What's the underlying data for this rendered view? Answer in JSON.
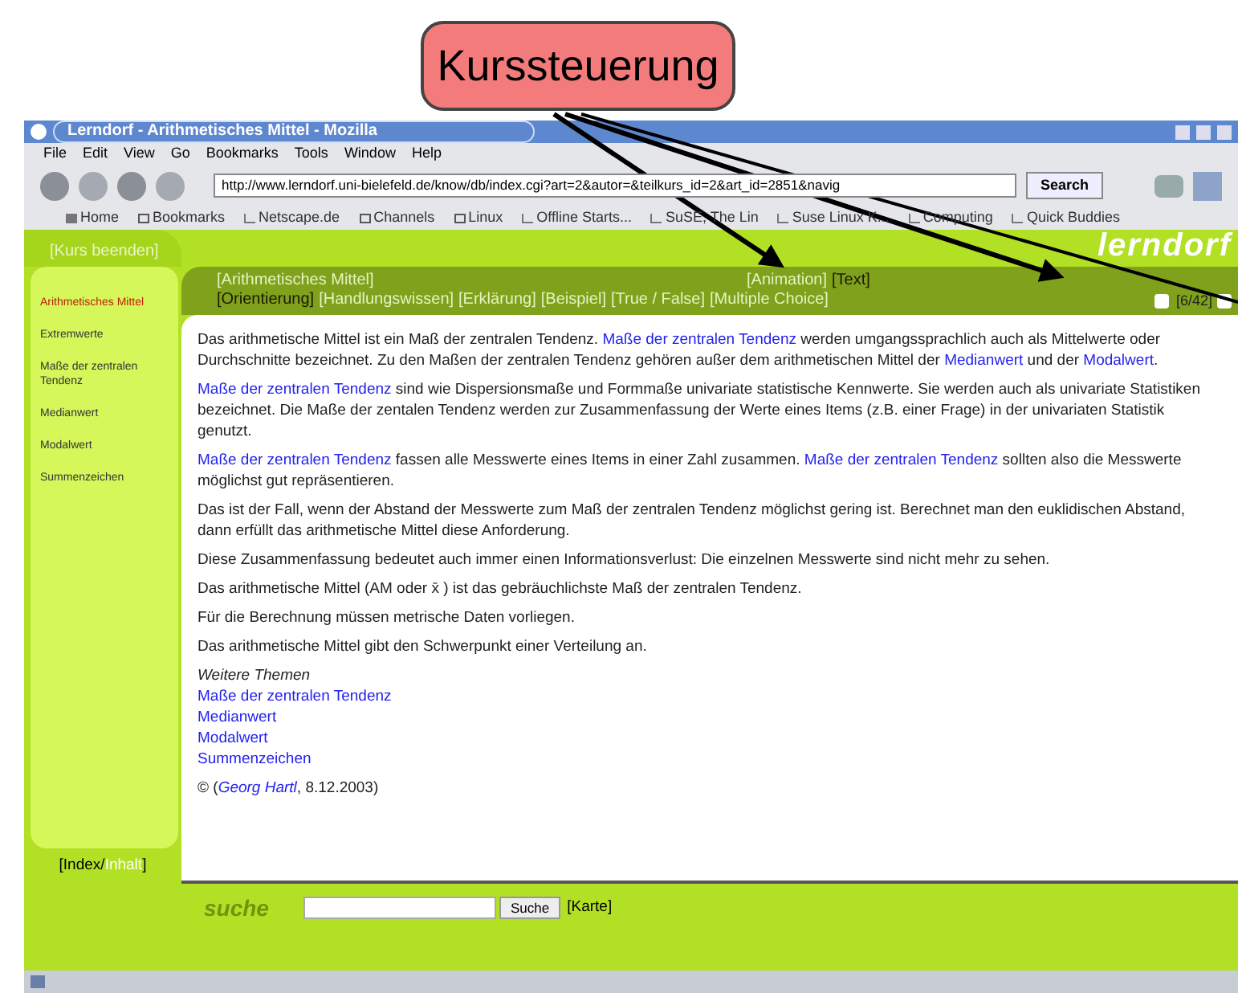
{
  "callout": {
    "label": "Kurssteuerung"
  },
  "window": {
    "title": "Lerndorf - Arithmetisches Mittel - Mozilla"
  },
  "menu": [
    "File",
    "Edit",
    "View",
    "Go",
    "Bookmarks",
    "Tools",
    "Window",
    "Help"
  ],
  "address": {
    "value": "http://www.lerndorf.uni-bielefeld.de/know/db/index.cgi?art=2&autor=&teilkurs_id=2&art_id=2851&navig"
  },
  "search_button": "Search",
  "bookmarks": [
    {
      "label": "Home",
      "kind": "home"
    },
    {
      "label": "Bookmarks",
      "kind": "folder"
    },
    {
      "label": "Netscape.de",
      "kind": "link"
    },
    {
      "label": "Channels",
      "kind": "folder"
    },
    {
      "label": "Linux",
      "kind": "folder"
    },
    {
      "label": "Offline Starts...",
      "kind": "link"
    },
    {
      "label": "SuSE, The Lin",
      "kind": "link"
    },
    {
      "label": "Suse Linux K...",
      "kind": "link"
    },
    {
      "label": "Computing",
      "kind": "link"
    },
    {
      "label": "Quick Buddies",
      "kind": "link"
    }
  ],
  "page": {
    "end_course": "[Kurs beenden]",
    "sidebar": [
      {
        "label": "Arithmetisches Mittel",
        "selected": true
      },
      {
        "label": "Extremwerte",
        "selected": false
      },
      {
        "label": "Maße der zentralen Tendenz",
        "selected": false
      },
      {
        "label": "Medianwert",
        "selected": false
      },
      {
        "label": "Modalwert",
        "selected": false
      },
      {
        "label": "Summenzeichen",
        "selected": false
      }
    ],
    "topic": "[Arithmetisches Mittel]",
    "media_tabs": [
      {
        "label": "[Animation]",
        "selected": false
      },
      {
        "label": "[Text]",
        "selected": true
      }
    ],
    "section_tabs": [
      {
        "label": "[Orientierung]",
        "selected": true
      },
      {
        "label": "[Handlungswissen]",
        "selected": false
      },
      {
        "label": "[Erklärung]",
        "selected": false
      },
      {
        "label": "[Beispiel]",
        "selected": false
      },
      {
        "label": "[True / False]",
        "selected": false
      },
      {
        "label": "[Multiple Choice]",
        "selected": false
      }
    ],
    "logo": "lerndorf",
    "pager": "[6/42]",
    "paragraphs": [
      [
        {
          "text": "Das arithmetische Mittel ist ein Maß der zentralen Tendenz. ",
          "kind": "text"
        },
        {
          "text": "Maße der zentralen Tendenz",
          "kind": "link"
        },
        {
          "text": " werden umgangssprachlich auch als Mittelwerte oder Durchschnitte bezeichnet. Zu den Maßen der zentralen Tendenz gehören außer dem arithmetischen Mittel der ",
          "kind": "text"
        },
        {
          "text": "Medianwert",
          "kind": "link"
        },
        {
          "text": " und der ",
          "kind": "text"
        },
        {
          "text": "Modalwert",
          "kind": "link"
        },
        {
          "text": ".",
          "kind": "text"
        }
      ],
      [
        {
          "text": "Maße der zentralen Tendenz",
          "kind": "link"
        },
        {
          "text": " sind wie Dispersionsmaße und Formmaße univariate statistische Kennwerte. Sie werden auch als univariate Statistiken bezeichnet. Die Maße der zentalen Tendenz werden zur Zusammenfassung der Werte eines Items (z.B. einer Frage) in der univariaten Statistik genutzt.",
          "kind": "text"
        }
      ],
      [
        {
          "text": "Maße der zentralen Tendenz",
          "kind": "link"
        },
        {
          "text": " fassen alle Messwerte eines Items in einer Zahl zusammen. ",
          "kind": "text"
        },
        {
          "text": "Maße der zentralen Tendenz",
          "kind": "link"
        },
        {
          "text": " sollten also die Messwerte möglichst gut repräsentieren.",
          "kind": "text"
        }
      ],
      [
        {
          "text": "Das ist der Fall, wenn der Abstand der Messwerte zum Maß der zentralen Tendenz möglichst gering ist. Berechnet man den euklidischen Abstand, dann erfüllt das arithmetische Mittel diese Anforderung.",
          "kind": "text"
        }
      ],
      [
        {
          "text": "Diese Zusammenfassung bedeutet auch immer einen Informationsverlust: Die einzelnen Messwerte sind nicht mehr zu sehen.",
          "kind": "text"
        }
      ],
      [
        {
          "text": "Das arithmetische Mittel (AM oder x̄ ) ist das gebräuchlichste Maß der zentralen Tendenz.",
          "kind": "text"
        }
      ],
      [
        {
          "text": "Für die Berechnung müssen metrische Daten vorliegen.",
          "kind": "text"
        }
      ],
      [
        {
          "text": "Das arithmetische Mittel gibt den Schwerpunkt einer Verteilung an.",
          "kind": "text"
        }
      ]
    ],
    "further_heading": "Weitere Themen",
    "further_links": [
      "Maße der zentralen Tendenz",
      "Medianwert",
      "Modalwert",
      "Summenzeichen"
    ],
    "credit": [
      {
        "text": "© (",
        "kind": "text"
      },
      {
        "text": "Georg Hartl",
        "kind": "link"
      },
      {
        "text": ", 8.12.2003)",
        "kind": "text"
      }
    ],
    "index_nav": [
      {
        "label": "[Index/",
        "selected": true
      },
      {
        "label": "Inhalt",
        "selected": false
      }
    ],
    "index_nav_close": "]",
    "search_label": "suche",
    "search_go": "Suche",
    "map_link": "[Karte]"
  }
}
